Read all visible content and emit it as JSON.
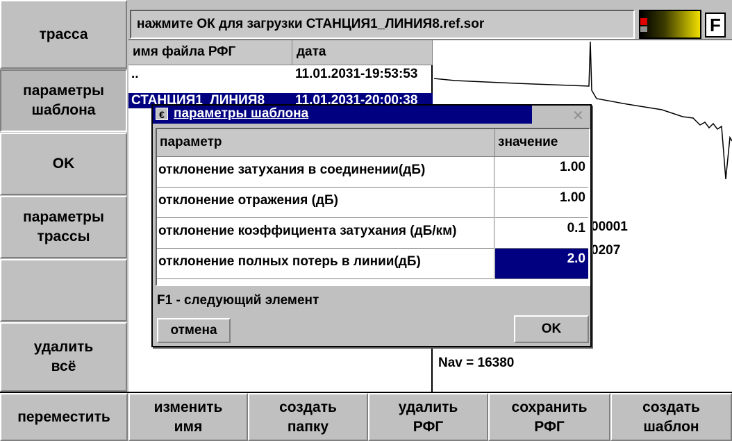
{
  "status_bar": {
    "message": "нажмите ОК для загрузки СТАНЦИЯ1_ЛИНИЯ8.ref.sor",
    "f_label": "F"
  },
  "left_menu": {
    "items": [
      {
        "label": "трасса"
      },
      {
        "label": "параметры\nшаблона"
      },
      {
        "label": "OK"
      },
      {
        "label": "параметры\nтрассы"
      },
      {
        "label": ""
      },
      {
        "label": "удалить\nвсё"
      }
    ]
  },
  "file_list": {
    "headers": {
      "name": "имя файла РФГ",
      "date": "дата"
    },
    "rows": [
      {
        "name": "..",
        "date": "11.01.2031-19:53:53"
      },
      {
        "name": "СТАНЦИЯ1_ЛИНИЯ8",
        "date": "11.01.2031-20:00:38"
      }
    ]
  },
  "trace_info": {
    "line1": "00001",
    "line2": "0207",
    "line3": "Nav = 16380"
  },
  "dialog": {
    "title": "параметры шаблона",
    "headers": {
      "param": "параметр",
      "value": "значение"
    },
    "rows": [
      {
        "param": "отклонение затухания в соединении(дБ)",
        "value": "1.00"
      },
      {
        "param": "отклонение отражения (дБ)",
        "value": "1.00"
      },
      {
        "param": "отклонение коэффициента затухания (дБ/км)",
        "value": "0.1"
      },
      {
        "param": "отклонение полных потерь в линии(дБ)",
        "value": "2.0"
      }
    ],
    "hint": "F1 - следующий элемент",
    "cancel": "отмена",
    "ok": "OK"
  },
  "bottom_menu": {
    "items": [
      {
        "label": "переместить"
      },
      {
        "label": "изменить\nимя"
      },
      {
        "label": "создать\nпапку"
      },
      {
        "label": "удалить\nРФГ"
      },
      {
        "label": "сохранить\nРФГ"
      },
      {
        "label": "создать\nшаблон"
      }
    ]
  }
}
